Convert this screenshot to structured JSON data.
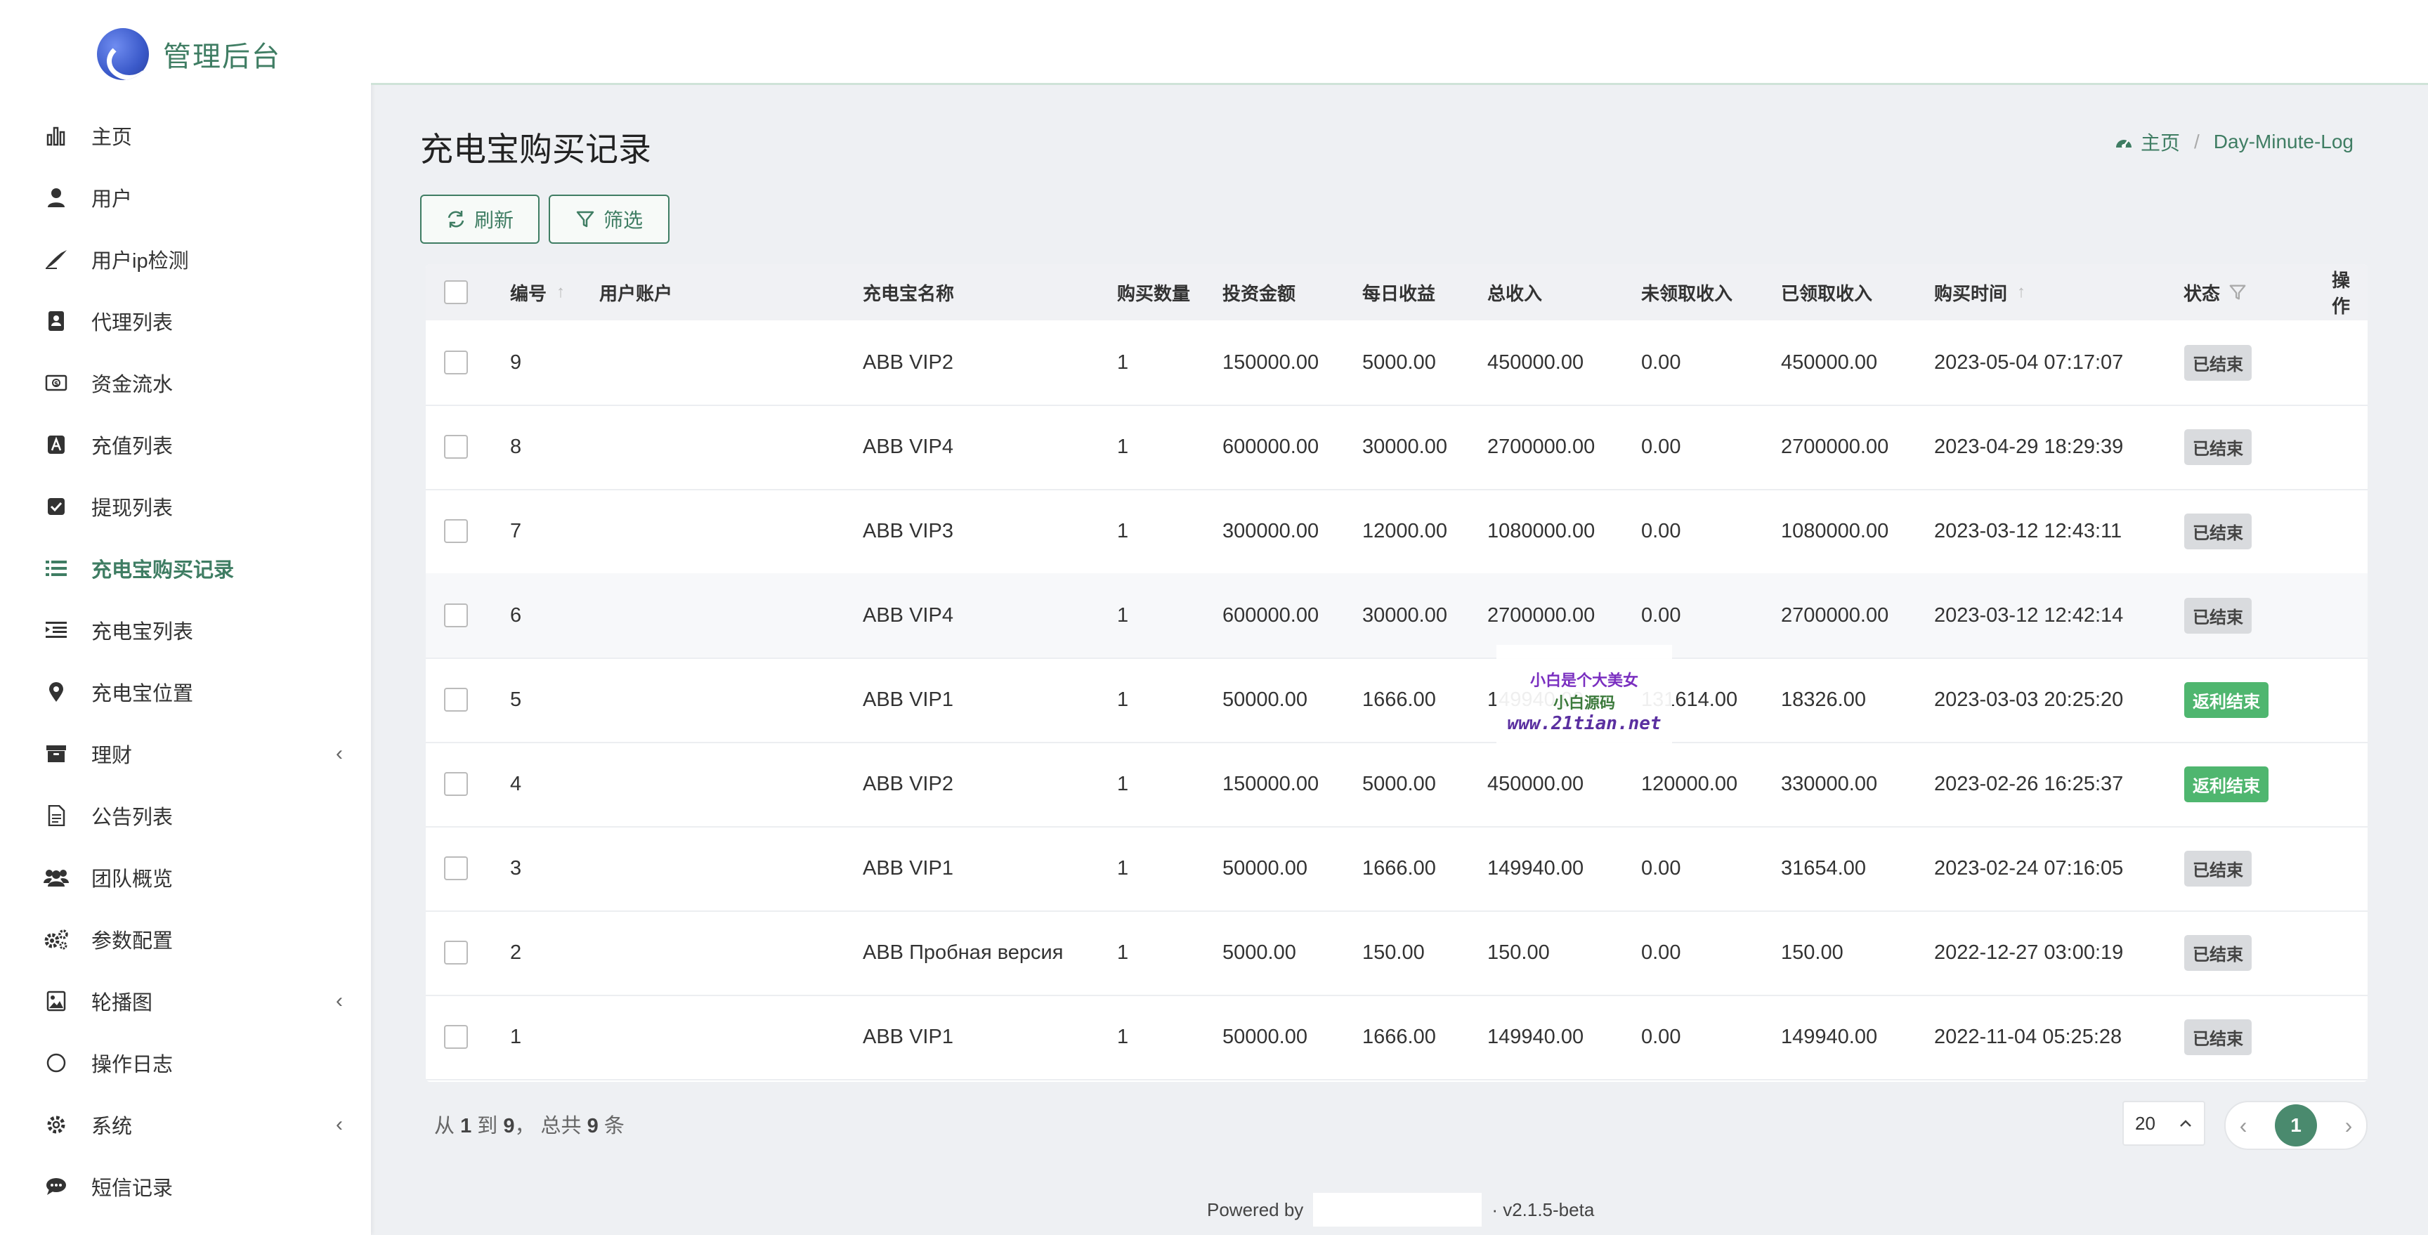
{
  "brand": {
    "title": "管理后台"
  },
  "sidebar": {
    "items": [
      {
        "label": "主页",
        "icon": "bar-chart-icon",
        "caret": ""
      },
      {
        "label": "用户",
        "icon": "user-icon",
        "caret": ""
      },
      {
        "label": "用户ip检测",
        "icon": "pen-icon",
        "caret": ""
      },
      {
        "label": "代理列表",
        "icon": "address-book-icon",
        "caret": ""
      },
      {
        "label": "资金流水",
        "icon": "money-icon",
        "caret": ""
      },
      {
        "label": "充值列表",
        "icon": "font-box-icon",
        "caret": ""
      },
      {
        "label": "提现列表",
        "icon": "check-square-icon",
        "caret": ""
      },
      {
        "label": "充电宝购买记录",
        "icon": "list-icon",
        "caret": ""
      },
      {
        "label": "充电宝列表",
        "icon": "indent-list-icon",
        "caret": ""
      },
      {
        "label": "充电宝位置",
        "icon": "map-marker-icon",
        "caret": ""
      },
      {
        "label": "理财",
        "icon": "archive-icon",
        "caret": "‹"
      },
      {
        "label": "公告列表",
        "icon": "document-icon",
        "caret": ""
      },
      {
        "label": "团队概览",
        "icon": "users-icon",
        "caret": ""
      },
      {
        "label": "参数配置",
        "icon": "cogs-icon",
        "caret": ""
      },
      {
        "label": "轮播图",
        "icon": "image-icon",
        "caret": "‹"
      },
      {
        "label": "操作日志",
        "icon": "circle-icon",
        "caret": ""
      },
      {
        "label": "系统",
        "icon": "gear-icon",
        "caret": "‹"
      },
      {
        "label": "短信记录",
        "icon": "comment-icon",
        "caret": ""
      }
    ],
    "active_index": 7
  },
  "page": {
    "title": "充电宝购买记录",
    "breadcrumb_home": "主页",
    "breadcrumb_current": "Day-Minute-Log"
  },
  "toolbar": {
    "refresh_label": "刷新",
    "filter_label": "筛选"
  },
  "table": {
    "columns": {
      "id": "编号",
      "account": "用户账户",
      "name": "充电宝名称",
      "qty": "购买数量",
      "invest": "投资金额",
      "daily": "每日收益",
      "total": "总收入",
      "unclaimed": "未领取收入",
      "claimed": "已领取收入",
      "time": "购买时间",
      "status": "状态",
      "action": "操作"
    },
    "rows": [
      {
        "id": "9",
        "account": "",
        "name": "ABB VIP2",
        "qty": "1",
        "invest": "150000.00",
        "daily": "5000.00",
        "total": "450000.00",
        "unclaimed": "0.00",
        "claimed": "450000.00",
        "time": "2023-05-04 07:17:07",
        "status": "已结束",
        "status_color": "gray"
      },
      {
        "id": "8",
        "account": "",
        "name": "ABB VIP4",
        "qty": "1",
        "invest": "600000.00",
        "daily": "30000.00",
        "total": "2700000.00",
        "unclaimed": "0.00",
        "claimed": "2700000.00",
        "time": "2023-04-29 18:29:39",
        "status": "已结束",
        "status_color": "gray"
      },
      {
        "id": "7",
        "account": "",
        "name": "ABB VIP3",
        "qty": "1",
        "invest": "300000.00",
        "daily": "12000.00",
        "total": "1080000.00",
        "unclaimed": "0.00",
        "claimed": "1080000.00",
        "time": "2023-03-12 12:43:11",
        "status": "已结束",
        "status_color": "gray"
      },
      {
        "id": "6",
        "account": "",
        "name": "ABB VIP4",
        "qty": "1",
        "invest": "600000.00",
        "daily": "30000.00",
        "total": "2700000.00",
        "unclaimed": "0.00",
        "claimed": "2700000.00",
        "time": "2023-03-12 12:42:14",
        "status": "已结束",
        "status_color": "gray"
      },
      {
        "id": "5",
        "account": "",
        "name": "ABB VIP1",
        "qty": "1",
        "invest": "50000.00",
        "daily": "1666.00",
        "total": "149940.00",
        "unclaimed": "131614.00",
        "claimed": "18326.00",
        "time": "2023-03-03 20:25:20",
        "status": "返利结束",
        "status_color": "green"
      },
      {
        "id": "4",
        "account": "",
        "name": "ABB VIP2",
        "qty": "1",
        "invest": "150000.00",
        "daily": "5000.00",
        "total": "450000.00",
        "unclaimed": "120000.00",
        "claimed": "330000.00",
        "time": "2023-02-26 16:25:37",
        "status": "返利结束",
        "status_color": "green"
      },
      {
        "id": "3",
        "account": "",
        "name": "ABB VIP1",
        "qty": "1",
        "invest": "50000.00",
        "daily": "1666.00",
        "total": "149940.00",
        "unclaimed": "0.00",
        "claimed": "31654.00",
        "time": "2023-02-24 07:16:05",
        "status": "已结束",
        "status_color": "gray"
      },
      {
        "id": "2",
        "account": "",
        "name": "ABB Пробная версия",
        "qty": "1",
        "invest": "5000.00",
        "daily": "150.00",
        "total": "150.00",
        "unclaimed": "0.00",
        "claimed": "150.00",
        "time": "2022-12-27 03:00:19",
        "status": "已结束",
        "status_color": "gray"
      },
      {
        "id": "1",
        "account": "",
        "name": "ABB VIP1",
        "qty": "1",
        "invest": "50000.00",
        "daily": "1666.00",
        "total": "149940.00",
        "unclaimed": "0.00",
        "claimed": "149940.00",
        "time": "2022-11-04 05:25:28",
        "status": "已结束",
        "status_color": "gray"
      }
    ]
  },
  "pagination": {
    "summary_prefix": "从",
    "from": "1",
    "to_word": "到",
    "to": "9",
    "total_prefix": "，  总共",
    "total": "9",
    "suffix": "条",
    "page_size": "20",
    "current_page": "1"
  },
  "footer": {
    "powered_by": "Powered by",
    "version": "· v2.1.5-beta"
  },
  "watermark": {
    "line1": "小白是个大美女",
    "line2": "小白源码",
    "line3": "www.21tian.net"
  },
  "colors": {
    "accent": "#3f7d63",
    "badge_gray": "#d9dbde",
    "badge_green": "#4fb66f"
  }
}
